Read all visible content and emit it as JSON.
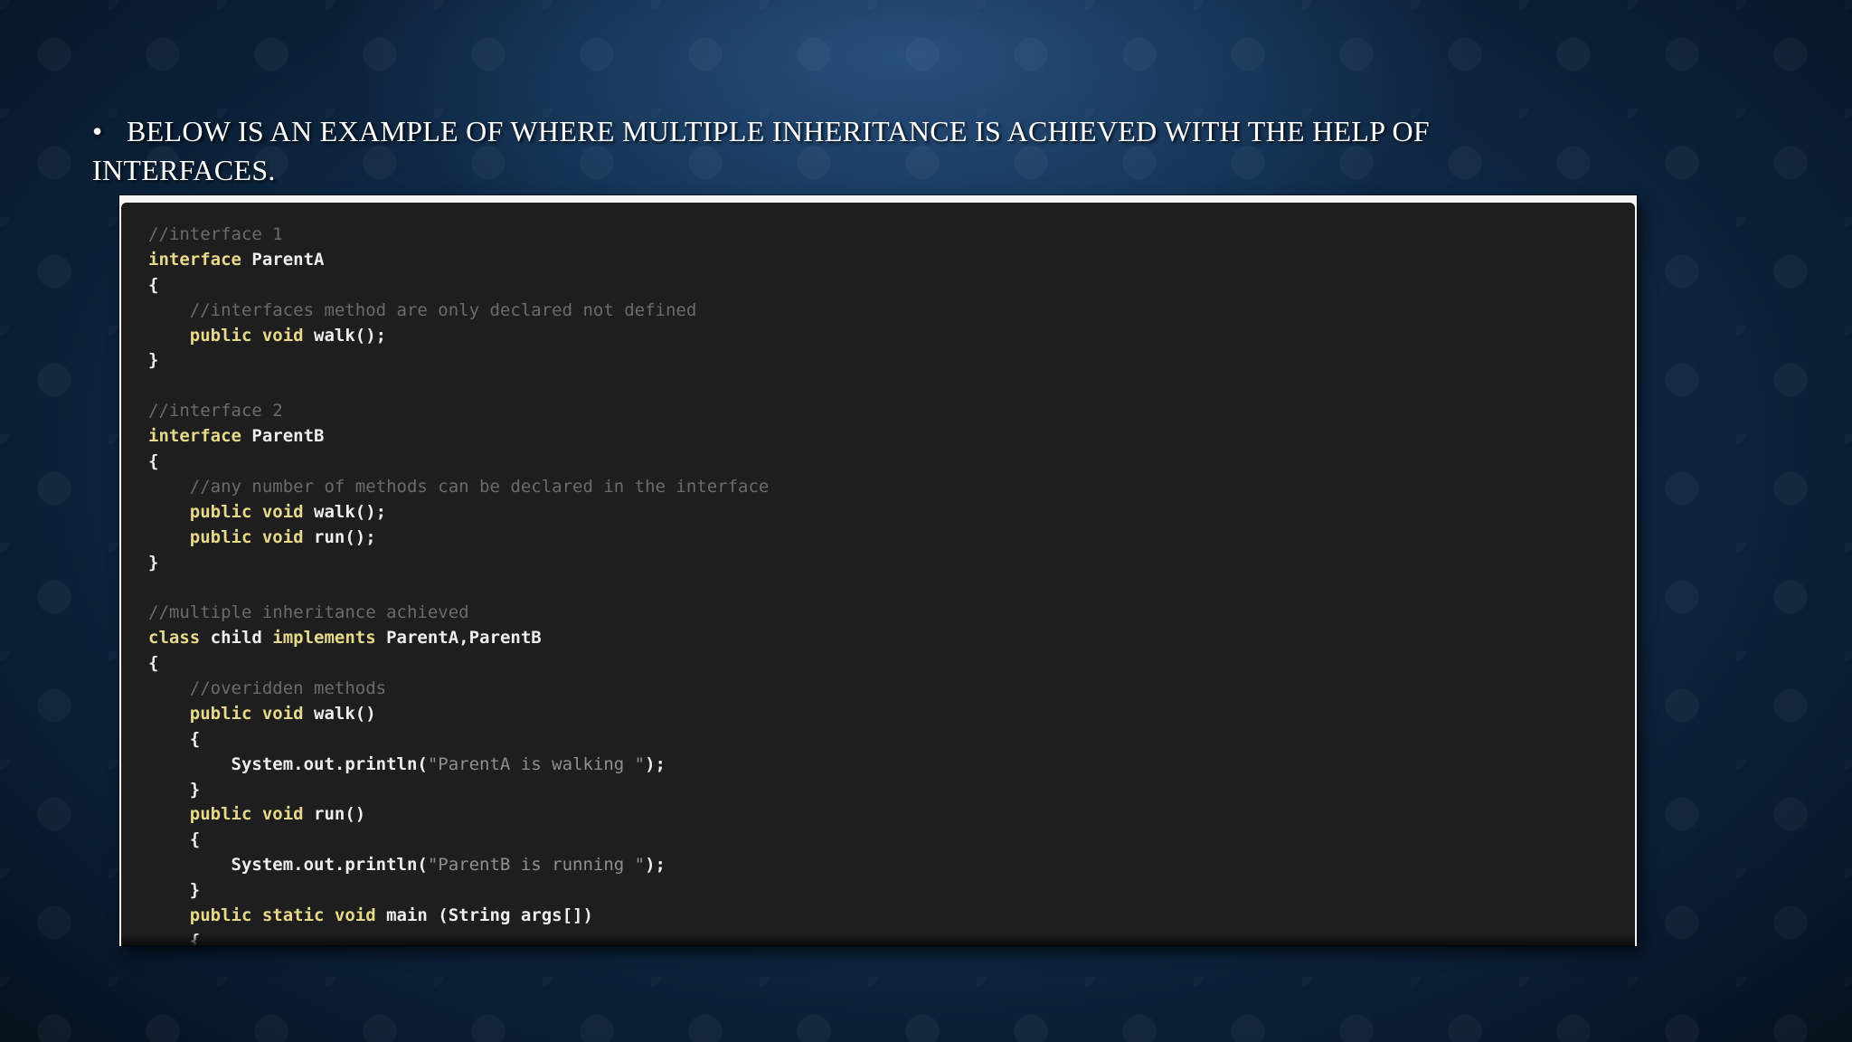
{
  "slide": {
    "bullet_symbol": "•",
    "text_line1": "BELOW IS AN EXAMPLE OF WHERE MULTIPLE INHERITANCE IS ACHIEVED WITH THE HELP OF",
    "text_line2": "INTERFACES."
  },
  "code": {
    "lines": [
      [
        {
          "t": "//interface 1",
          "c": "cm"
        }
      ],
      [
        {
          "t": "interface",
          "c": "kw"
        },
        {
          "t": " ParentA",
          "c": "id"
        }
      ],
      [
        {
          "t": "{",
          "c": "id"
        }
      ],
      [
        {
          "t": "    ",
          "c": "id"
        },
        {
          "t": "//interfaces method are only declared not defined",
          "c": "cm"
        }
      ],
      [
        {
          "t": "    ",
          "c": "id"
        },
        {
          "t": "public void",
          "c": "kw"
        },
        {
          "t": " walk();",
          "c": "id"
        }
      ],
      [
        {
          "t": "}",
          "c": "id"
        }
      ],
      [
        {
          "t": "",
          "c": "id"
        }
      ],
      [
        {
          "t": "//interface 2",
          "c": "cm"
        }
      ],
      [
        {
          "t": "interface",
          "c": "kw"
        },
        {
          "t": " ParentB",
          "c": "id"
        }
      ],
      [
        {
          "t": "{",
          "c": "id"
        }
      ],
      [
        {
          "t": "    ",
          "c": "id"
        },
        {
          "t": "//any number of methods can be declared in the interface",
          "c": "cm"
        }
      ],
      [
        {
          "t": "    ",
          "c": "id"
        },
        {
          "t": "public void",
          "c": "kw"
        },
        {
          "t": " walk();",
          "c": "id"
        }
      ],
      [
        {
          "t": "    ",
          "c": "id"
        },
        {
          "t": "public void",
          "c": "kw"
        },
        {
          "t": " run();",
          "c": "id"
        }
      ],
      [
        {
          "t": "}",
          "c": "id"
        }
      ],
      [
        {
          "t": "",
          "c": "id"
        }
      ],
      [
        {
          "t": "//multiple inheritance achieved",
          "c": "cm"
        }
      ],
      [
        {
          "t": "class",
          "c": "kw"
        },
        {
          "t": " child ",
          "c": "id"
        },
        {
          "t": "implements",
          "c": "kw"
        },
        {
          "t": " ParentA,ParentB",
          "c": "id"
        }
      ],
      [
        {
          "t": "{",
          "c": "id"
        }
      ],
      [
        {
          "t": "    ",
          "c": "id"
        },
        {
          "t": "//overidden methods",
          "c": "cm"
        }
      ],
      [
        {
          "t": "    ",
          "c": "id"
        },
        {
          "t": "public void",
          "c": "kw"
        },
        {
          "t": " walk()",
          "c": "id"
        }
      ],
      [
        {
          "t": "    {",
          "c": "id"
        }
      ],
      [
        {
          "t": "        System.out.println(",
          "c": "id"
        },
        {
          "t": "\"ParentA is walking \"",
          "c": "str"
        },
        {
          "t": ");",
          "c": "id"
        }
      ],
      [
        {
          "t": "    }",
          "c": "id"
        }
      ],
      [
        {
          "t": "    ",
          "c": "id"
        },
        {
          "t": "public void",
          "c": "kw"
        },
        {
          "t": " run()",
          "c": "id"
        }
      ],
      [
        {
          "t": "    {",
          "c": "id"
        }
      ],
      [
        {
          "t": "        System.out.println(",
          "c": "id"
        },
        {
          "t": "\"ParentB is running \"",
          "c": "str"
        },
        {
          "t": ");",
          "c": "id"
        }
      ],
      [
        {
          "t": "    }",
          "c": "id"
        }
      ],
      [
        {
          "t": "    ",
          "c": "id"
        },
        {
          "t": "public static void",
          "c": "kw"
        },
        {
          "t": " main (String args[])",
          "c": "id"
        }
      ],
      [
        {
          "t": "    {",
          "c": "id"
        }
      ]
    ]
  }
}
